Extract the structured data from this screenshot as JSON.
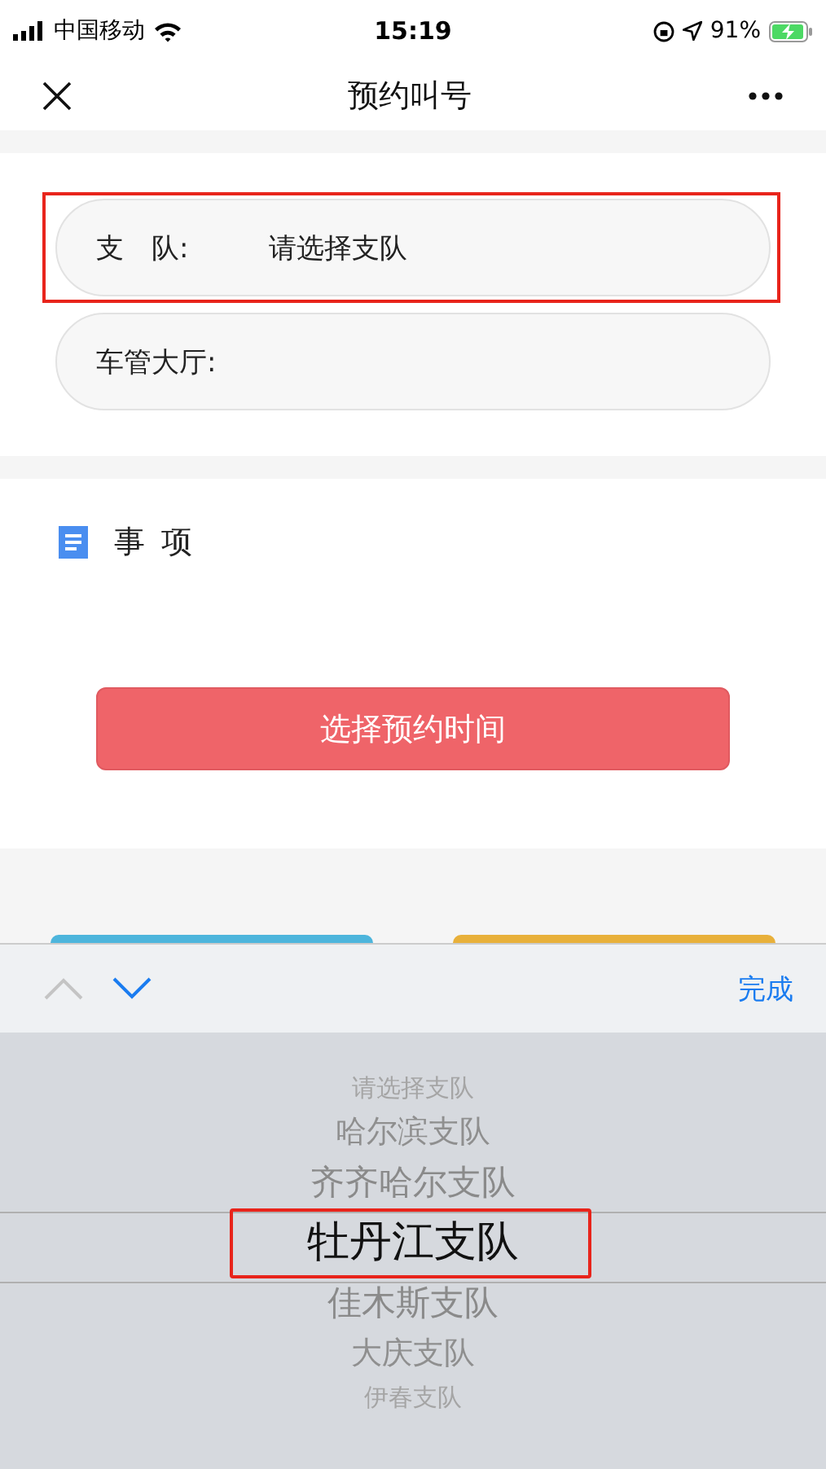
{
  "status_bar": {
    "carrier": "中国移动",
    "time": "15:19",
    "battery": "91%"
  },
  "nav": {
    "title": "预约叫号"
  },
  "fields": [
    {
      "label": "支　队:",
      "value": "请选择支队",
      "highlighted": true
    },
    {
      "label": "车管大厅:",
      "highlighted": false
    }
  ],
  "section": {
    "title": "事 项"
  },
  "primary_button": "选择预约时间",
  "toolbar": {
    "prev_disabled": true,
    "next_disabled": false,
    "done": "完成"
  },
  "picker": [
    {
      "label": "请选择支队",
      "selected": false
    },
    {
      "label": "哈尔滨支队",
      "selected": false
    },
    {
      "label": "齐齐哈尔支队",
      "selected": false
    },
    {
      "label": "牡丹江支队",
      "selected": true
    },
    {
      "label": "佳木斯支队",
      "selected": false
    },
    {
      "label": "大庆支队",
      "selected": false
    },
    {
      "label": "伊春支队",
      "selected": false
    }
  ]
}
